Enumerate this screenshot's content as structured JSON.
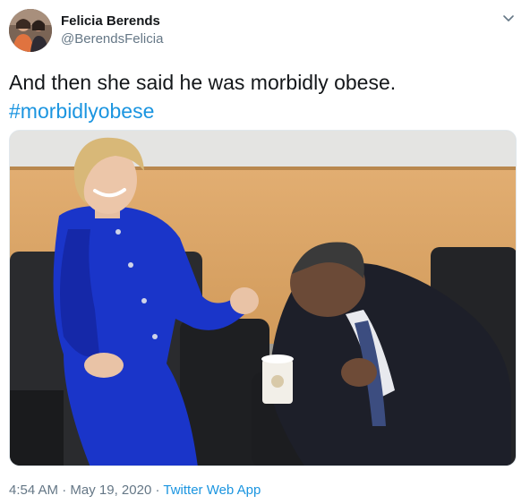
{
  "user": {
    "display_name": "Felicia Berends",
    "handle": "@BerendsFelicia"
  },
  "tweet": {
    "text": "And then she said he was morbidly obese.",
    "hashtag": "#morbidlyobese"
  },
  "meta": {
    "time": "4:54 AM",
    "separator1": " · ",
    "date": "May 19, 2020",
    "separator2": " · ",
    "source": "Twitter Web App"
  },
  "icons": {
    "menu": "chevron-down-icon"
  },
  "colors": {
    "link": "#1b95e0",
    "text": "#14171a",
    "secondary": "#657786",
    "suit_blue": "#1a35c9"
  }
}
